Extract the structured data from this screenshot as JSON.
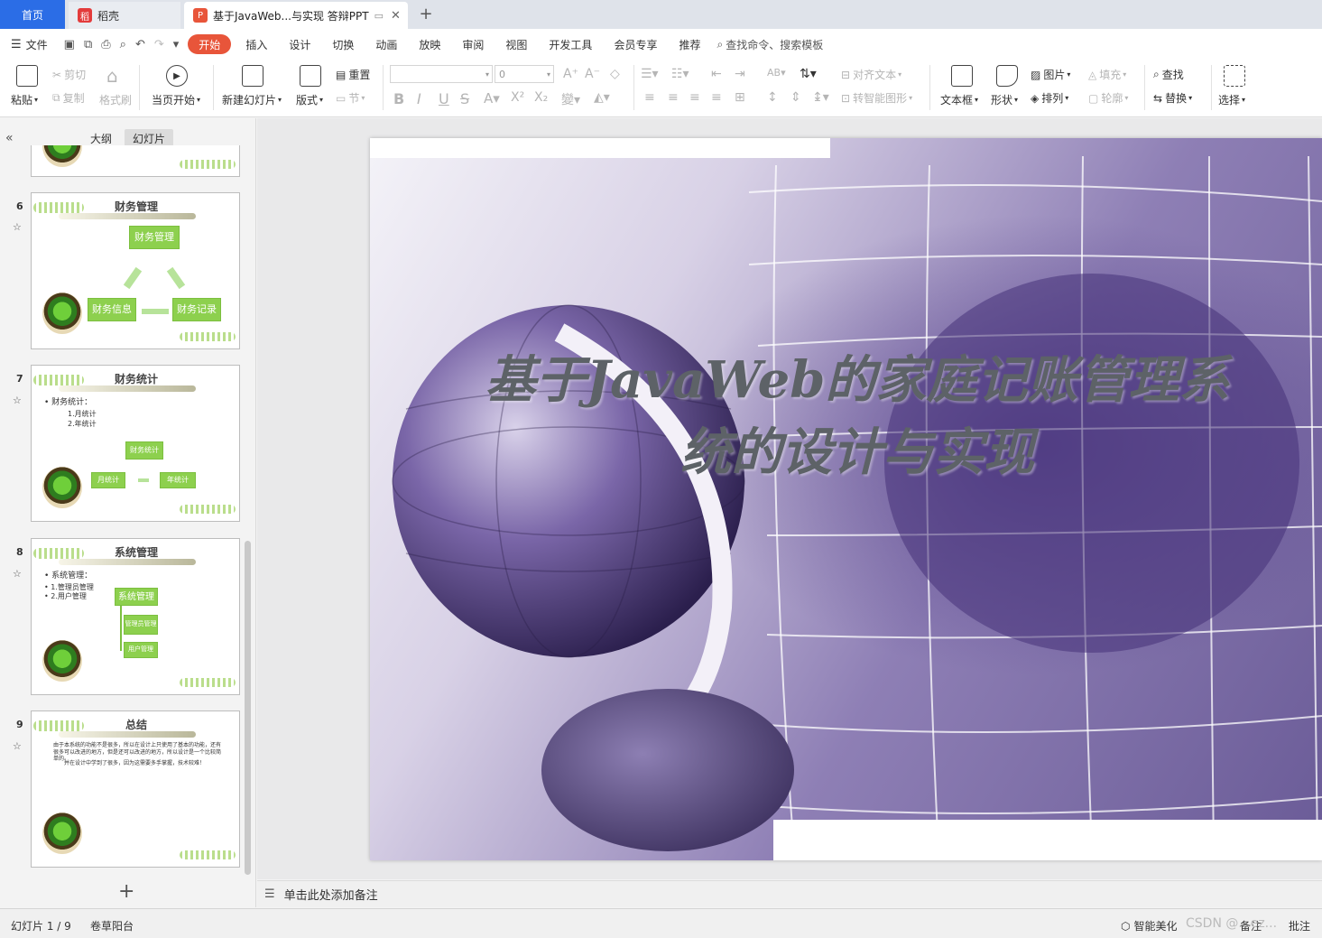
{
  "tabs": {
    "home": "首页",
    "docer": "稻壳",
    "document": "基于JavaWeb...与实现 答辩PPT"
  },
  "menu": {
    "file": "文件",
    "items": [
      "开始",
      "插入",
      "设计",
      "切换",
      "动画",
      "放映",
      "审阅",
      "视图",
      "开发工具",
      "会员专享",
      "推荐"
    ],
    "search": "查找命令、搜索模板"
  },
  "ribbon": {
    "paste": "粘贴",
    "cut": "剪切",
    "copy": "复制",
    "format_painter": "格式刷",
    "from_current": "当页开始",
    "new_slide": "新建幻灯片",
    "layout": "版式",
    "reset": "重置",
    "section": "节",
    "font_size": "0",
    "align_text": "对齐文本",
    "smart_art": "转智能图形",
    "textbox": "文本框",
    "shape": "形状",
    "picture": "图片",
    "arrange": "排列",
    "fill": "填充",
    "outline": "轮廓",
    "find": "查找",
    "replace": "替换",
    "select": "选择"
  },
  "panel": {
    "outline_tab": "大纲",
    "slides_tab": "幻灯片"
  },
  "slides": [
    {
      "num": "6",
      "title": "财务管理",
      "boxes": [
        "财务管理",
        "财务信息",
        "财务记录"
      ]
    },
    {
      "num": "7",
      "title": "财务统计",
      "bullets": [
        "财务统计：",
        "1.月统计",
        "2.年统计"
      ],
      "boxes": [
        "财务统计",
        "月统计",
        "年统计"
      ]
    },
    {
      "num": "8",
      "title": "系统管理",
      "bullets": [
        "系统管理：",
        "1.管理员管理",
        "2.用户管理"
      ],
      "boxes": [
        "系统管理",
        "管理员管理",
        "用户管理"
      ]
    },
    {
      "num": "9",
      "title": "总结",
      "text": [
        "由于本系统的功能不是很多，所以在设计上只使用了基本的功能，还有很多可以改进的地方，但是还可以改进的地方，所以设计是一个比较简单的。",
        "并在设计中学到了很多，因为这需要多手掌握，技术较难！"
      ]
    }
  ],
  "main_slide": {
    "title_line1": "基于JavaWeb的家庭记账管理系",
    "title_line2": "统的设计与实现"
  },
  "notes_placeholder": "单击此处添加备注",
  "status": {
    "slide_counter": "幻灯片 1 / 9",
    "theme": "卷草阳台",
    "smart_beautify": "智能美化",
    "notes": "备注",
    "comments": "批注",
    "watermark": "CSDN @...ez..."
  }
}
